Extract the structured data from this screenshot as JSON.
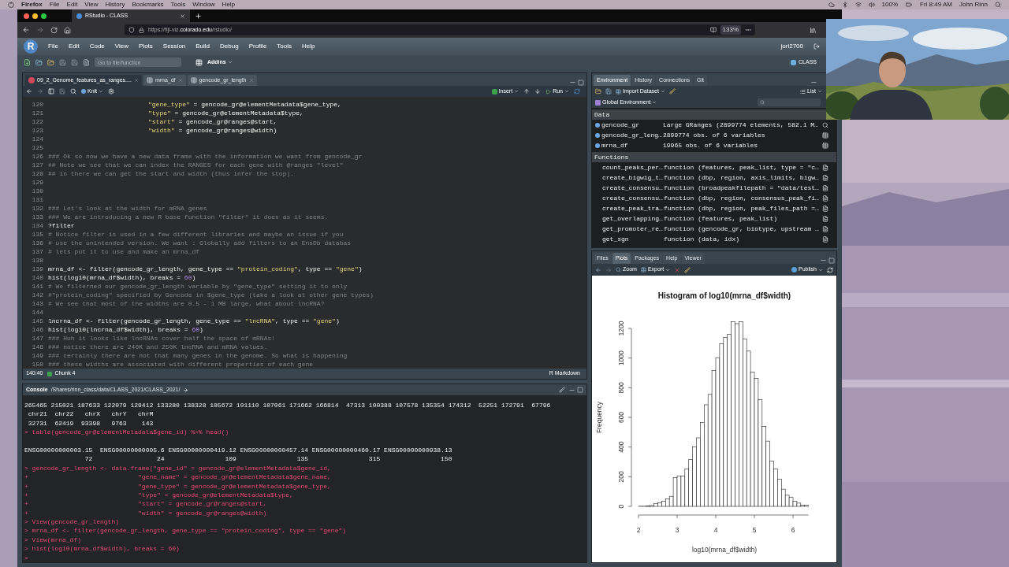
{
  "mac_menu_bar": {
    "app": "Firefox",
    "menus": [
      "File",
      "Edit",
      "View",
      "History",
      "Bookmarks",
      "Tools",
      "Window",
      "Help"
    ],
    "battery": "100%",
    "clock": "Fri 8:49 AM",
    "user": "John Rinn"
  },
  "browser": {
    "tabs": [
      {
        "title": "RStudio - CLASS",
        "selected": true
      }
    ],
    "url_prefix": "https://fiji-viz.",
    "url_domain": "colorado.edu",
    "url_path": "/rstudio/",
    "zoom": "133%"
  },
  "rstudio": {
    "logo": "R",
    "menus": [
      "File",
      "Edit",
      "Code",
      "View",
      "Plots",
      "Session",
      "Build",
      "Debug",
      "Profile",
      "Tools",
      "Help"
    ],
    "user": "jori2700",
    "search_placeholder": "Go to file/function",
    "addins": "Addins",
    "project": "CLASS"
  },
  "editor": {
    "tabs": [
      {
        "label": "09_2_Genome_features_as_ranges....",
        "kind": "document",
        "selected": true
      },
      {
        "label": "mrna_df",
        "kind": "table",
        "selected": false
      },
      {
        "label": "gencode_gr_length",
        "kind": "table",
        "selected": false
      }
    ],
    "knit": "Knit",
    "insert": "Insert",
    "run": "Run",
    "lines": [
      {
        "number": "120",
        "kind": "continuation",
        "tokens": [
          {
            "kind": "string",
            "text": "\"gene_type\""
          },
          {
            "kind": "plain",
            "text": " = gencode_gr@elementMetadata$gene_type,"
          }
        ]
      },
      {
        "number": "121",
        "kind": "continuation",
        "tokens": [
          {
            "kind": "string",
            "text": "\"type\""
          },
          {
            "kind": "plain",
            "text": " = gencode_gr@elementMetadata$type,"
          }
        ]
      },
      {
        "number": "122",
        "kind": "continuation",
        "tokens": [
          {
            "kind": "string",
            "text": "\"start\""
          },
          {
            "kind": "plain",
            "text": " = gencode_gr@ranges@start,"
          }
        ]
      },
      {
        "number": "123",
        "kind": "continuation",
        "tokens": [
          {
            "kind": "string",
            "text": "\"width\""
          },
          {
            "kind": "plain",
            "text": " = gencode_gr@ranges@width)"
          }
        ]
      },
      {
        "number": "124",
        "kind": "blank"
      },
      {
        "number": "125",
        "kind": "blank"
      },
      {
        "number": "126",
        "kind": "code",
        "tokens": [
          {
            "kind": "comment",
            "text": "### Ok so now we have a new data frame with the information we want from gencode_gr"
          }
        ]
      },
      {
        "number": "127",
        "kind": "code",
        "tokens": [
          {
            "kind": "comment",
            "text": "## Note we see that we can index the RANGES for each gene with @ranges \"level\""
          }
        ]
      },
      {
        "number": "128",
        "kind": "code",
        "tokens": [
          {
            "kind": "comment",
            "text": "## in there we can get the start and width (thus infer the stop)."
          }
        ]
      },
      {
        "number": "129",
        "kind": "blank"
      },
      {
        "number": "130",
        "kind": "blank"
      },
      {
        "number": "131",
        "kind": "blank"
      },
      {
        "number": "132",
        "kind": "code",
        "tokens": [
          {
            "kind": "comment",
            "text": "### Let's look at the width for mRNA genes"
          }
        ]
      },
      {
        "number": "133",
        "kind": "code",
        "tokens": [
          {
            "kind": "comment",
            "text": "### We are introducing a new R base function \"filter\" it does as it seems."
          }
        ]
      },
      {
        "number": "134",
        "kind": "code",
        "tokens": [
          {
            "kind": "plain",
            "text": "?filter"
          }
        ]
      },
      {
        "number": "135",
        "kind": "code",
        "tokens": [
          {
            "kind": "comment",
            "text": "# Notice filter is used in a few different libraries and maybe an issue if you"
          }
        ]
      },
      {
        "number": "136",
        "kind": "code",
        "tokens": [
          {
            "kind": "comment",
            "text": "# use the unintended version. We want : Globally add filters to an EnsDb databas"
          }
        ]
      },
      {
        "number": "137",
        "kind": "code",
        "tokens": [
          {
            "kind": "comment",
            "text": "# lets put it to use and make an mrna_df"
          }
        ]
      },
      {
        "number": "138",
        "kind": "blank"
      },
      {
        "number": "139",
        "kind": "code",
        "tokens": [
          {
            "kind": "plain",
            "text": "mrna_df <- filter(gencode_gr_length, gene_type == "
          },
          {
            "kind": "string",
            "text": "\"protein_coding\""
          },
          {
            "kind": "plain",
            "text": ", type == "
          },
          {
            "kind": "string",
            "text": "\"gene\""
          },
          {
            "kind": "plain",
            "text": ")"
          }
        ]
      },
      {
        "number": "140",
        "kind": "code",
        "tokens": [
          {
            "kind": "plain",
            "text": "hist(log10(mrna_df$width), breaks = "
          },
          {
            "kind": "number",
            "text": "60"
          },
          {
            "kind": "plain",
            "text": ")"
          }
        ]
      },
      {
        "number": "141",
        "kind": "code",
        "tokens": [
          {
            "kind": "comment",
            "text": "# We filterned our gencode_gr_length variable by \"gene_type\" setting it to only"
          }
        ]
      },
      {
        "number": "142",
        "kind": "code",
        "tokens": [
          {
            "kind": "comment",
            "text": "#\"protein_coding\" specified by Gencode in $gene_type (take a look at other gene types)"
          }
        ]
      },
      {
        "number": "143",
        "kind": "code",
        "tokens": [
          {
            "kind": "comment",
            "text": "# We see that most of the widths are 0.5 - 1 MB large, what about lncRNA?"
          }
        ]
      },
      {
        "number": "144",
        "kind": "blank"
      },
      {
        "number": "145",
        "kind": "code",
        "tokens": [
          {
            "kind": "plain",
            "text": "lncrna_df <- filter(gencode_gr_length, gene_type == "
          },
          {
            "kind": "string",
            "text": "\"lncRNA\""
          },
          {
            "kind": "plain",
            "text": ", type == "
          },
          {
            "kind": "string",
            "text": "\"gene\""
          },
          {
            "kind": "plain",
            "text": ")"
          }
        ]
      },
      {
        "number": "146",
        "kind": "code",
        "tokens": [
          {
            "kind": "plain",
            "text": "hist(log10(lncrna_df$width), breaks = "
          },
          {
            "kind": "number",
            "text": "60"
          },
          {
            "kind": "plain",
            "text": ")"
          }
        ]
      },
      {
        "number": "147",
        "kind": "code",
        "tokens": [
          {
            "kind": "comment",
            "text": "### Huh it looks like lncRNAs cover half the space of mRNAs!"
          }
        ]
      },
      {
        "number": "148",
        "kind": "code",
        "tokens": [
          {
            "kind": "comment",
            "text": "### notice there are 240K and 250K lncRNA and mRNA values."
          }
        ]
      },
      {
        "number": "149",
        "kind": "code",
        "tokens": [
          {
            "kind": "comment",
            "text": "### certainly there are not that many genes in the genome. So what is happening"
          }
        ]
      },
      {
        "number": "150",
        "kind": "code",
        "tokens": [
          {
            "kind": "comment",
            "text": "### these widths are associated with different properties of each gene"
          }
        ]
      }
    ],
    "position": "140:40",
    "chunk": "Chunk 4",
    "mode": "R Markdown"
  },
  "console": {
    "title": "Console",
    "path": "/Shares/rinn_class/data/CLASS_2021/CLASS_2021/",
    "lines": [
      {
        "kind": "output",
        "text": "265465 215021 187633 122079 129412 133280 138328 105672 101110 107061 171662 166814  47313 100388 107578 135354 174312  52251 172791  67796"
      },
      {
        "kind": "output",
        "text": " chr21  chr22   chrX   chrY   chrM"
      },
      {
        "kind": "output",
        "text": " 32731  62419  93398   9763    143"
      },
      {
        "kind": "input",
        "text": "> table(gencode_gr@elementMetadata$gene_id) %>% head()"
      },
      {
        "kind": "blank"
      },
      {
        "kind": "output",
        "text": "ENSG00000000003.15  ENSG00000000005.6 ENSG00000000419.12 ENSG00000000457.14 ENSG00000000460.17 ENSG00000000938.13"
      },
      {
        "kind": "output",
        "text": "                72                 24                109                135                315                150"
      },
      {
        "kind": "input",
        "text": "> gencode_gr_length <- data.frame(\"gene_id\" = gencode_gr@elementMetadata$gene_id,"
      },
      {
        "kind": "input",
        "text": "+                             \"gene_name\" = gencode_gr@elementMetadata$gene_name,"
      },
      {
        "kind": "input",
        "text": "+                             \"gene_type\" = gencode_gr@elementMetadata$gene_type,"
      },
      {
        "kind": "input",
        "text": "+                             \"type\" = gencode_gr@elementMetadata$type,"
      },
      {
        "kind": "input",
        "text": "+                             \"start\" = gencode_gr@ranges@start,"
      },
      {
        "kind": "input",
        "text": "+                             \"width\" = gencode_gr@ranges@width)"
      },
      {
        "kind": "input",
        "text": "> View(gencode_gr_length)"
      },
      {
        "kind": "input",
        "text": "> mrna_df <- filter(gencode_gr_length, gene_type == \"protein_coding\", type == \"gene\")"
      },
      {
        "kind": "input",
        "text": "> View(mrna_df)"
      },
      {
        "kind": "input",
        "text": "> hist(log10(mrna_df$width), breaks = 60)"
      },
      {
        "kind": "prompt",
        "text": ">"
      }
    ]
  },
  "environment": {
    "tabs": [
      {
        "label": "Environment",
        "selected": true
      },
      {
        "label": "History",
        "selected": false
      },
      {
        "label": "Connections",
        "selected": false
      },
      {
        "label": "Git",
        "selected": false
      }
    ],
    "import": "Import Dataset",
    "view": "List",
    "scope": "Global Environment",
    "sections": [
      {
        "title": "Data",
        "rows": [
          {
            "name": "gencode_gr",
            "value": "Large GRanges (2899774 elements, 582.1 M…",
            "kind": "object"
          },
          {
            "name": "gencode_gr_leng…",
            "value": "2899774 obs. of 6 variables",
            "kind": "table"
          },
          {
            "name": "mrna_df",
            "value": "19965 obs. of 6 variables",
            "kind": "table"
          }
        ]
      },
      {
        "title": "Functions",
        "rows": [
          {
            "name": "count_peaks_per…",
            "value": "function (features, peak_list, type = \"c…",
            "kind": "function"
          },
          {
            "name": "create_bigwig_t…",
            "value": "function (dbp, region, axis_limits, bigw…",
            "kind": "function"
          },
          {
            "name": "create_consensu…",
            "value": "function (broadpeakfilepath = \"data/test…",
            "kind": "function"
          },
          {
            "name": "create_consensu…",
            "value": "function (dbp, region, consensus_peak_fi…",
            "kind": "function"
          },
          {
            "name": "create_peak_tra…",
            "value": "function (dbp, region, peak_files_path =…",
            "kind": "function"
          },
          {
            "name": "get_overlapping…",
            "value": "function (features, peak_list)",
            "kind": "function"
          },
          {
            "name": "get_promoter_re…",
            "value": "function (gencode_gr, biotype, upstream …",
            "kind": "function"
          },
          {
            "name": "get_sgn",
            "value": "function (data, idx)",
            "kind": "function"
          }
        ]
      }
    ]
  },
  "plots": {
    "tabs": [
      {
        "label": "Files",
        "selected": false
      },
      {
        "label": "Plots",
        "selected": true
      },
      {
        "label": "Packages",
        "selected": false
      },
      {
        "label": "Help",
        "selected": false
      },
      {
        "label": "Viewer",
        "selected": false
      }
    ],
    "zoom": "Zoom",
    "export": "Export",
    "publish": "Publish",
    "chart_data": {
      "type": "bar",
      "title": "Histogram of log10(mrna_df$width)",
      "xlabel": "log10(mrna_df$width)",
      "ylabel": "Frequency",
      "x": [
        2.05,
        2.15,
        2.25,
        2.35,
        2.45,
        2.55,
        2.65,
        2.75,
        2.85,
        2.95,
        3.05,
        3.15,
        3.25,
        3.35,
        3.45,
        3.55,
        3.65,
        3.75,
        3.85,
        3.95,
        4.05,
        4.15,
        4.25,
        4.35,
        4.45,
        4.55,
        4.65,
        4.75,
        4.85,
        4.95,
        5.05,
        5.15,
        5.25,
        5.35,
        5.45,
        5.55,
        5.65,
        5.75,
        5.85,
        5.95,
        6.05,
        6.15,
        6.25,
        6.35
      ],
      "values": [
        1,
        1,
        3,
        5,
        18,
        25,
        35,
        50,
        68,
        193,
        205,
        205,
        252,
        316,
        400,
        462,
        565,
        685,
        755,
        915,
        1003,
        1097,
        1140,
        1160,
        1245,
        1232,
        1245,
        1130,
        1047,
        905,
        862,
        720,
        540,
        440,
        306,
        252,
        183,
        116,
        75,
        60,
        35,
        22,
        8,
        8
      ],
      "xlim": [
        2,
        6.4
      ],
      "ylim": [
        0,
        1250
      ],
      "xticks": [
        2,
        3,
        4,
        5,
        6
      ],
      "yticks": [
        0,
        200,
        400,
        600,
        800,
        1000,
        1200
      ]
    }
  }
}
